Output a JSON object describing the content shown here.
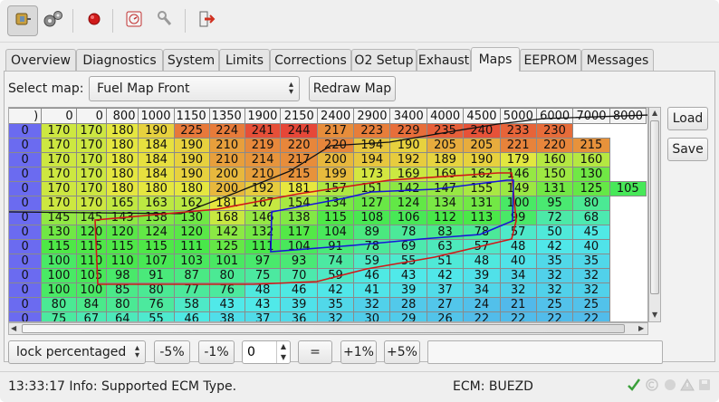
{
  "toolbar": {
    "icons": [
      "connect-icon",
      "settings-gears-icon",
      "record-icon",
      "dashboard-icon",
      "tools-icon",
      "exit-icon"
    ],
    "colors": {
      "record": "#d01a1a",
      "exit": "#d03020"
    }
  },
  "tabs": [
    "Overview",
    "Diagnostics",
    "System",
    "Limits",
    "Corrections",
    "O2 Setup",
    "Exhaust",
    "Maps",
    "EEPROM",
    "Messages"
  ],
  "active_tab": "Maps",
  "map_select": {
    "label": "Select map:",
    "value": "Fuel Map Front",
    "redraw_label": "Redraw Map"
  },
  "side_buttons": {
    "load": "Load",
    "save": "Save"
  },
  "grid": {
    "corner": ")",
    "rpm_header": [
      "0",
      "0",
      "800",
      "1000",
      "1150",
      "1350",
      "1900",
      "2150",
      "2400",
      "2900",
      "3400",
      "4000",
      "4500",
      "5000",
      "6000",
      "7000",
      "8000"
    ],
    "rows": [
      {
        "load": "0",
        "values": [
          "170",
          "170",
          "180",
          "190",
          "225",
          "224",
          "241",
          "244",
          "217",
          "223",
          "229",
          "235",
          "240",
          "233",
          "230"
        ]
      },
      {
        "load": "0",
        "values": [
          "170",
          "170",
          "180",
          "184",
          "190",
          "210",
          "219",
          "220",
          "220",
          "194",
          "190",
          "205",
          "205",
          "221",
          "220",
          "215"
        ]
      },
      {
        "load": "0",
        "values": [
          "170",
          "170",
          "180",
          "184",
          "190",
          "210",
          "214",
          "217",
          "200",
          "194",
          "192",
          "189",
          "190",
          "179",
          "160",
          "160"
        ]
      },
      {
        "load": "0",
        "values": [
          "170",
          "170",
          "180",
          "184",
          "190",
          "200",
          "210",
          "215",
          "199",
          "173",
          "169",
          "169",
          "162",
          "146",
          "150",
          "130"
        ]
      },
      {
        "load": "0",
        "values": [
          "170",
          "170",
          "180",
          "180",
          "180",
          "200",
          "192",
          "181",
          "157",
          "151",
          "142",
          "147",
          "155",
          "149",
          "131",
          "125",
          "105"
        ]
      },
      {
        "load": "0",
        "values": [
          "170",
          "170",
          "165",
          "163",
          "162",
          "181",
          "167",
          "154",
          "134",
          "127",
          "124",
          "134",
          "131",
          "100",
          "95",
          "80"
        ]
      },
      {
        "load": "0",
        "values": [
          "145",
          "145",
          "143",
          "138",
          "130",
          "168",
          "146",
          "138",
          "115",
          "108",
          "106",
          "112",
          "113",
          "99",
          "72",
          "68"
        ]
      },
      {
        "load": "0",
        "values": [
          "130",
          "120",
          "120",
          "124",
          "120",
          "142",
          "132",
          "117",
          "104",
          "89",
          "78",
          "83",
          "78",
          "57",
          "50",
          "45"
        ]
      },
      {
        "load": "0",
        "values": [
          "115",
          "115",
          "115",
          "115",
          "111",
          "125",
          "111",
          "104",
          "91",
          "78",
          "69",
          "63",
          "57",
          "48",
          "42",
          "40"
        ]
      },
      {
        "load": "0",
        "values": [
          "100",
          "110",
          "110",
          "107",
          "103",
          "101",
          "97",
          "93",
          "74",
          "59",
          "55",
          "51",
          "48",
          "40",
          "35",
          "35"
        ]
      },
      {
        "load": "0",
        "values": [
          "100",
          "105",
          "98",
          "91",
          "87",
          "80",
          "75",
          "70",
          "59",
          "46",
          "43",
          "42",
          "39",
          "34",
          "32",
          "32"
        ]
      },
      {
        "load": "0",
        "values": [
          "100",
          "100",
          "85",
          "80",
          "77",
          "76",
          "48",
          "46",
          "42",
          "41",
          "39",
          "37",
          "34",
          "32",
          "32",
          "32"
        ]
      },
      {
        "load": "0",
        "values": [
          "80",
          "84",
          "80",
          "76",
          "58",
          "43",
          "43",
          "39",
          "35",
          "32",
          "28",
          "27",
          "24",
          "21",
          "25",
          "25"
        ]
      },
      {
        "load": "0",
        "values": [
          "75",
          "67",
          "64",
          "55",
          "46",
          "38",
          "37",
          "36",
          "32",
          "30",
          "29",
          "26",
          "22",
          "22",
          "22",
          "22"
        ]
      }
    ]
  },
  "adjust": {
    "mode": "lock percentaged",
    "minus5": "-5%",
    "minus1": "-1%",
    "step_value": "0",
    "equals": "=",
    "plus1": "+1%",
    "plus5": "+5%"
  },
  "status": {
    "message": "13:33:17 Info: Supported ECM Type.",
    "ecm": "ECM: BUEZD",
    "ok_color": "#3aa03a"
  }
}
